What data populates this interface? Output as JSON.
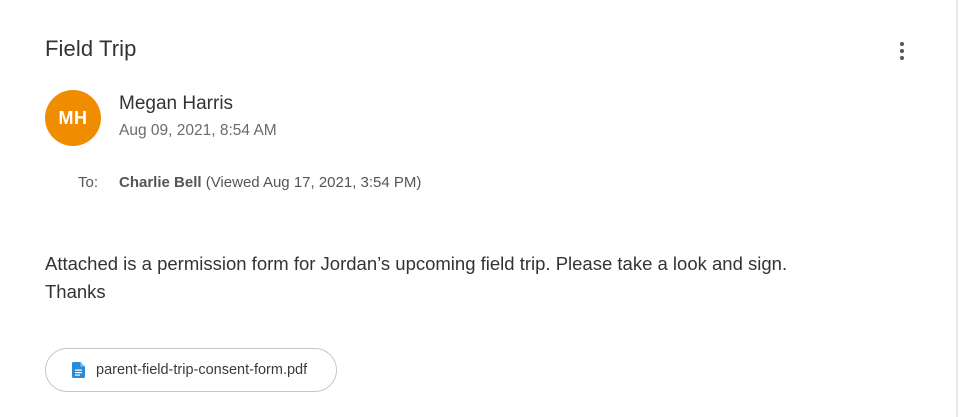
{
  "message": {
    "subject": "Field Trip",
    "sender": {
      "initials": "MH",
      "name": "Megan Harris",
      "sent_time": "Aug 09, 2021, 8:54 AM",
      "avatar_color": "#f08c00"
    },
    "to_label": "To:",
    "recipient": {
      "name": "Charlie Bell",
      "status": "(Viewed Aug 17, 2021, 3:54 PM)"
    },
    "body_line1": "Attached is a permission form for Jordan’s upcoming field trip. Please take a look and sign.",
    "body_line2": "Thanks",
    "attachment": {
      "filename": "parent-field-trip-consent-form.pdf",
      "icon": "document-icon",
      "icon_color": "#2a8ad6"
    },
    "menu_icon": "more-vertical-icon"
  }
}
